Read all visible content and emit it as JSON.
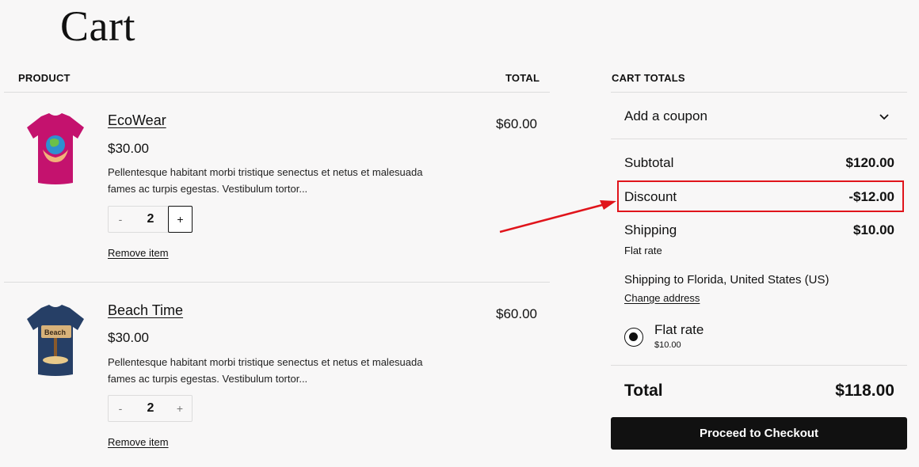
{
  "page": {
    "title": "Cart"
  },
  "cart_table": {
    "header_product": "PRODUCT",
    "header_total": "TOTAL",
    "items": [
      {
        "name": "EcoWear",
        "price": "$30.00",
        "description": "Pellentesque habitant morbi tristique senectus et netus et malesuada fames ac turpis egestas. Vestibulum tortor...",
        "quantity": "2",
        "minus": "-",
        "plus": "+",
        "remove_label": "Remove item",
        "line_total": "$60.00",
        "shirt_color": "#c4126e",
        "image_icon": "tshirt-globe-icon"
      },
      {
        "name": "Beach Time",
        "price": "$30.00",
        "description": "Pellentesque habitant morbi tristique senectus et netus et malesuada fames ac turpis egestas. Vestibulum tortor...",
        "quantity": "2",
        "minus": "-",
        "plus": "+",
        "remove_label": "Remove item",
        "line_total": "$60.00",
        "shirt_color": "#263f66",
        "image_icon": "tshirt-beach-sign-icon",
        "sign_text": "Beach"
      }
    ]
  },
  "totals": {
    "header": "CART TOTALS",
    "coupon_label": "Add a coupon",
    "subtotal_label": "Subtotal",
    "subtotal_value": "$120.00",
    "discount_label": "Discount",
    "discount_value": "-$12.00",
    "shipping_label": "Shipping",
    "shipping_value": "$10.00",
    "shipping_method": "Flat rate",
    "shipping_to": "Shipping to Florida, United States (US)",
    "change_address": "Change address",
    "rate_option_label": "Flat rate",
    "rate_option_price": "$10.00",
    "total_label": "Total",
    "total_value": "$118.00",
    "checkout_label": "Proceed to Checkout"
  },
  "annotation": {
    "highlight_color": "#e0141b"
  }
}
